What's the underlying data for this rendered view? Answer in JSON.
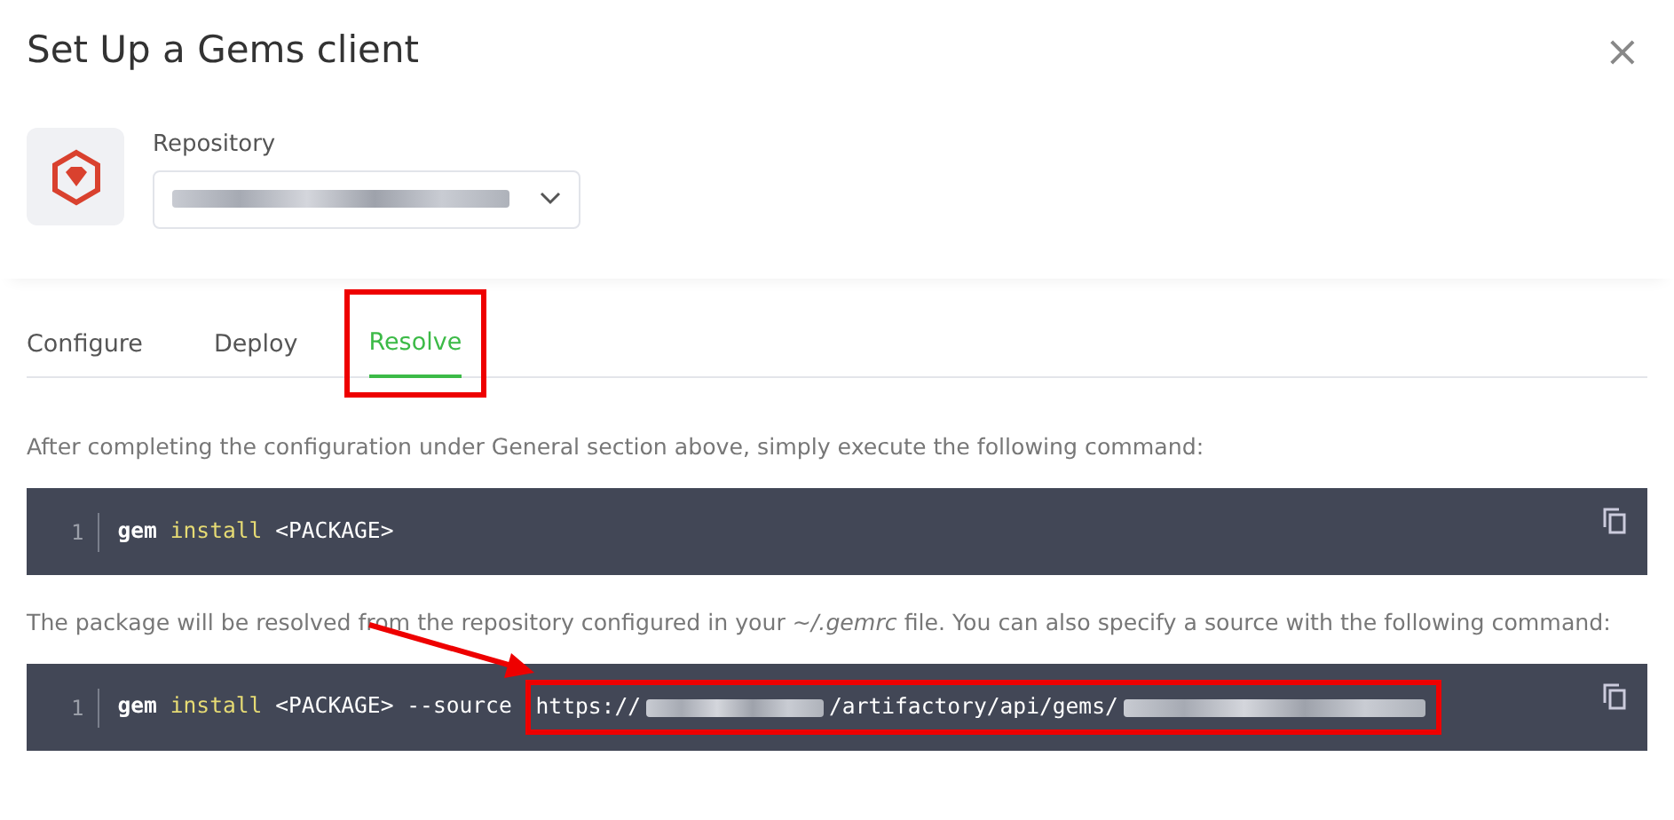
{
  "dialog": {
    "title": "Set Up a Gems client",
    "close": "×"
  },
  "repository": {
    "label": "Repository",
    "value_redacted": true
  },
  "tabs": [
    {
      "label": "Configure",
      "selected": false
    },
    {
      "label": "Deploy",
      "selected": false
    },
    {
      "label": "Resolve",
      "selected": true,
      "highlighted": true
    }
  ],
  "sections": [
    {
      "text": "After completing the configuration under General section above, simply execute the following command:",
      "code": {
        "line_number": "1",
        "tokens": [
          {
            "kind": "command",
            "text": "gem"
          },
          {
            "kind": "keyword",
            "text": "install"
          },
          {
            "kind": "plain",
            "text": "<PACKAGE>"
          }
        ],
        "highlighted": false
      }
    },
    {
      "text": "The package will be resolved from the repository configured in your *~/.gemrc* file. You can also specify a source with the following command:",
      "code": {
        "line_number": "1",
        "tokens": [
          {
            "kind": "command",
            "text": "gem"
          },
          {
            "kind": "keyword",
            "text": "install"
          },
          {
            "kind": "plain",
            "text": "<PACKAGE>"
          },
          {
            "kind": "plain",
            "text": "--source"
          },
          {
            "kind": "url",
            "text": "https://"
          },
          {
            "kind": "redacted"
          },
          {
            "kind": "url",
            "text": "/artifactory/api/gems/"
          },
          {
            "kind": "redacted"
          }
        ],
        "highlighted": true
      }
    }
  ]
}
